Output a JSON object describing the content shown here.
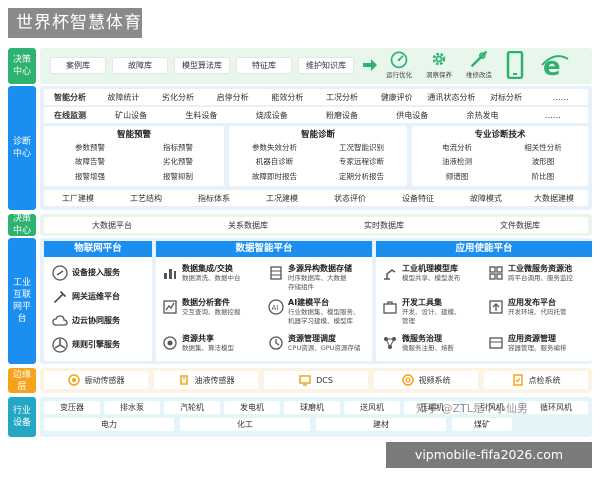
{
  "title": "世界杯智慧体育",
  "layers": {
    "decision1": {
      "label": "决策中心",
      "chips": [
        "案例库",
        "故障库",
        "模型算法库",
        "特征库",
        "维护知识库"
      ],
      "icons": [
        {
          "name": "运行优化"
        },
        {
          "name": "洞察保养"
        },
        {
          "name": "维修改造"
        },
        {
          "name": ""
        },
        {
          "name": ""
        }
      ]
    },
    "diagnosis": {
      "label": "诊断中心",
      "row1": [
        "智能分析",
        "故障统计",
        "劣化分析",
        "启停分析",
        "能效分析",
        "工况分析",
        "健康评价",
        "通讯状态分析",
        "对标分析",
        "……"
      ],
      "row2": [
        "在线监测",
        "矿山设备",
        "生料设备",
        "烧成设备",
        "粉磨设备",
        "供电设备",
        "余热发电",
        "……"
      ],
      "panel1": {
        "title": "智能预警",
        "items": [
          "参数预警",
          "指标预警",
          "故障告警",
          "劣化预警",
          "报警增强",
          "报警抑制"
        ]
      },
      "panel2": {
        "title": "智能诊断",
        "items": [
          "参数失效分析",
          "工况智能识别",
          "机器自诊断",
          "专家远程诊断",
          "故障即时报告",
          "定期分析报告"
        ]
      },
      "panel3": {
        "title": "专业诊断技术",
        "items": [
          "电流分析",
          "相关性分析",
          "油液检测",
          "波形图",
          "频谱图",
          "阶比图"
        ]
      },
      "row3": [
        "工厂建模",
        "工艺结构",
        "指标体系",
        "工况建模",
        "状态评价",
        "设备特征",
        "故障模式",
        "大数据建模"
      ]
    },
    "decision2": {
      "label": "决策中心",
      "chips": [
        "大数据平台",
        "关系数据库",
        "实时数据库",
        "文件数据库"
      ]
    },
    "platform": {
      "label": "工业互联网平台",
      "iot": {
        "title": "物联网平台",
        "items": [
          "设备接入服务",
          "网关运维平台",
          "边云协同服务",
          "规则引擎服务"
        ]
      },
      "data": {
        "title": "数据智能平台",
        "items": [
          {
            "title": "数据集成/交换",
            "desc": [
              "数据清洗、数据中台"
            ]
          },
          {
            "title": "多源异构数据存储",
            "desc": [
              "时序数据库、大数据",
              "存储组件"
            ]
          },
          {
            "title": "数据分析套件",
            "desc": [
              "交互查询、数据挖掘"
            ]
          },
          {
            "title": "AI建模平台",
            "desc": [
              "行业数据集、模型服务、",
              "机器学习建模、模型库"
            ]
          },
          {
            "title": "资源共享",
            "desc": [
              "数据集、算法模型"
            ]
          },
          {
            "title": "资源管理调度",
            "desc": [
              "CPU资源、GPU资源存储"
            ]
          }
        ]
      },
      "app": {
        "title": "应用使能平台",
        "items": [
          {
            "title": "工业机理模型库",
            "desc": [
              "模型共享、模型发布"
            ]
          },
          {
            "title": "工业微服务资源池",
            "desc": [
              "跨平台调用、服务监控"
            ]
          },
          {
            "title": "开发工具集",
            "desc": [
              "开发、设计、建模、",
              "管理"
            ]
          },
          {
            "title": "应用发布平台",
            "desc": [
              "开发环境、代码托管"
            ]
          },
          {
            "title": "微服务治理",
            "desc": [
              "微服务注册、熔断"
            ]
          },
          {
            "title": "应用资源管理",
            "desc": [
              "容器管理、服务编排"
            ]
          }
        ]
      }
    },
    "edge": {
      "label": "边缘层",
      "chips": [
        "振动传感器",
        "油液传感器",
        "DCS",
        "视频系统",
        "点检系统"
      ]
    },
    "industry": {
      "label": "行业设备",
      "row1": [
        "变压器",
        "排水泵",
        "汽轮机",
        "发电机",
        "球磨机",
        "送风机",
        "压缩机",
        "引风机",
        "循环风机"
      ],
      "row2": [
        "电力",
        "化工",
        "建材",
        "煤矿"
      ]
    }
  },
  "watermark": "知乎 @ZTL是个小仙男",
  "url": "vipmobile-fifa2026.com",
  "colors": {
    "green": "#2db36f",
    "blue": "#1a8ff0",
    "orange": "#f5a21c",
    "teal": "#23a7c5"
  }
}
